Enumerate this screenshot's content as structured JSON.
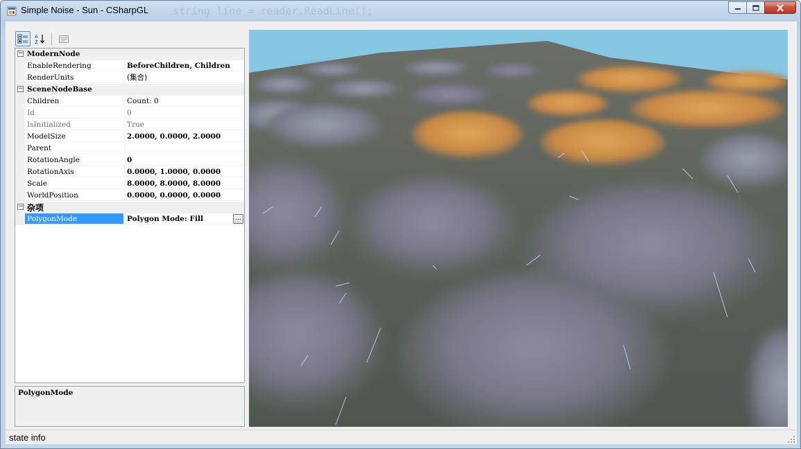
{
  "window": {
    "title": "Simple Noise - Sun - CSharpGL",
    "ghost_code": "string line = reader.ReadLine();"
  },
  "toolbar": {
    "categorized_icon": "categorized-view-icon",
    "alphabetical_icon": "sort-az-icon",
    "property_pages_icon": "property-pages-icon"
  },
  "property_grid": {
    "categories": [
      {
        "name": "ModernNode",
        "toggle": "−",
        "properties": [
          {
            "name": "EnableRendering",
            "value": "BeforeChildren, Children"
          },
          {
            "name": "RenderUnits",
            "value": "(集合)"
          }
        ]
      },
      {
        "name": "SceneNodeBase",
        "toggle": "−",
        "properties": [
          {
            "name": "Children",
            "value": "Count: 0"
          },
          {
            "name": "Id",
            "value": "0"
          },
          {
            "name": "IsInitialized",
            "value": "True"
          },
          {
            "name": "ModelSize",
            "value": "2.0000, 0.0000, 2.0000"
          },
          {
            "name": "Parent",
            "value": ""
          },
          {
            "name": "RotationAngle",
            "value": "0"
          },
          {
            "name": "RotationAxis",
            "value": "0.0000, 1.0000, 0.0000"
          },
          {
            "name": "Scale",
            "value": "8.0000, 8.0000, 8.0000"
          },
          {
            "name": "WorldPosition",
            "value": "0.0000, 0.0000, 0.0000"
          }
        ]
      },
      {
        "name": "杂项",
        "toggle": "−",
        "properties": [
          {
            "name": "PolygonMode",
            "value": "Polygon Mode: Fill",
            "ellipsis": "..."
          }
        ]
      }
    ]
  },
  "help": {
    "title": "PolygonMode"
  },
  "status": {
    "text": "state info"
  },
  "colors": {
    "selection": "#3399ff",
    "sky": "#86c7e4",
    "terrain": "#5d6660"
  }
}
